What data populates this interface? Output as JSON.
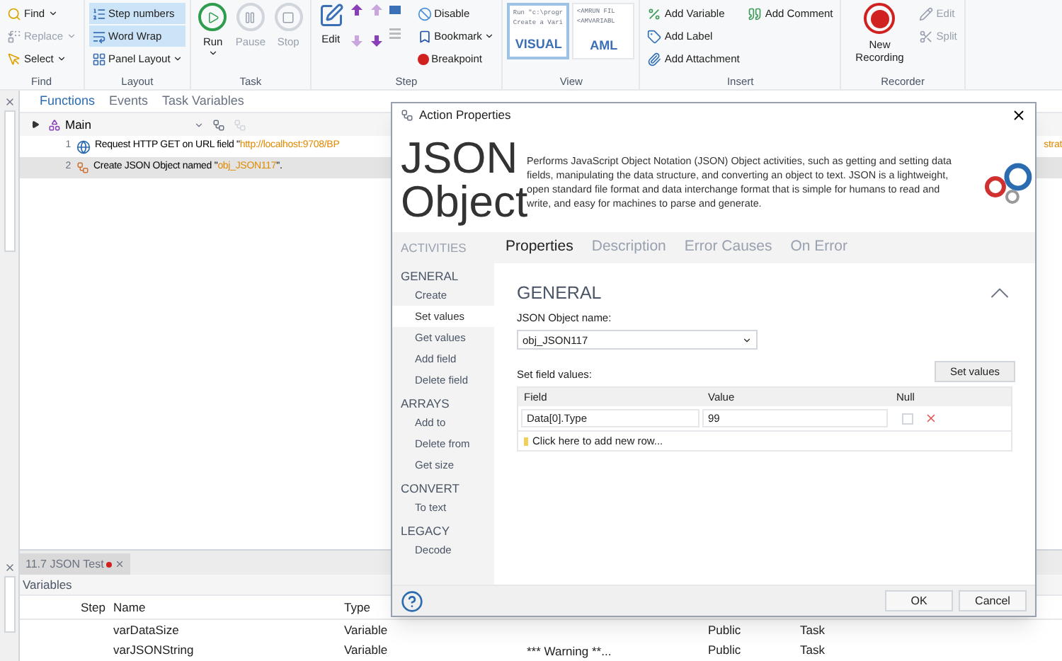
{
  "ribbon": {
    "groups": [
      {
        "label": "Find",
        "columns": [
          [
            {
              "kind": "small",
              "label": "Find",
              "dropdown": true,
              "disabled": false,
              "selected": false
            },
            {
              "kind": "small",
              "label": "Replace",
              "dropdown": true,
              "disabled": true,
              "selected": false
            },
            {
              "kind": "small",
              "label": "Select",
              "dropdown": true,
              "disabled": false,
              "selected": false
            }
          ]
        ]
      },
      {
        "label": "Layout",
        "columns": [
          [
            {
              "kind": "small",
              "label": "Step numbers",
              "dropdown": false,
              "disabled": false,
              "selected": true
            },
            {
              "kind": "small",
              "label": "Word Wrap",
              "dropdown": false,
              "disabled": false,
              "selected": true
            },
            {
              "kind": "small",
              "label": "Panel Layout",
              "dropdown": true,
              "disabled": false,
              "selected": false
            }
          ]
        ]
      },
      {
        "label": "Task",
        "columns": [
          [
            {
              "kind": "large",
              "label": "Run",
              "dropdown": true,
              "disabled": false,
              "selected": false
            }
          ],
          [
            {
              "kind": "large",
              "label": "Pause",
              "dropdown": false,
              "disabled": true,
              "selected": false
            }
          ],
          [
            {
              "kind": "large",
              "label": "Stop",
              "dropdown": false,
              "disabled": true,
              "selected": false
            }
          ]
        ]
      },
      {
        "label": "Step",
        "columns": [
          [
            {
              "kind": "large",
              "label": "Edit",
              "dropdown": false,
              "disabled": false,
              "selected": false
            }
          ],
          [
            {
              "kind": "arrows"
            }
          ],
          [
            {
              "kind": "small",
              "label": "Disable",
              "dropdown": false,
              "disabled": false,
              "selected": false
            },
            {
              "kind": "small",
              "label": "Bookmark",
              "dropdown": true,
              "disabled": false,
              "selected": false
            },
            {
              "kind": "small",
              "label": "Breakpoint",
              "dropdown": false,
              "disabled": false,
              "selected": false
            }
          ]
        ]
      },
      {
        "label": "View",
        "columns": [
          [
            {
              "kind": "thumb",
              "label": "VISUAL",
              "preview": [
                "Run \"c:\\progr",
                "Create a Vari"
              ],
              "selected": true
            }
          ],
          [
            {
              "kind": "thumb",
              "label": "AML",
              "preview": [
                "<AMRUN FIL",
                "<AMVARIABL"
              ],
              "selected": false
            }
          ]
        ]
      },
      {
        "label": "Insert",
        "columns": [
          [
            {
              "kind": "small",
              "label": "Add Variable",
              "dropdown": false,
              "disabled": false,
              "selected": false
            },
            {
              "kind": "small",
              "label": "Add Label",
              "dropdown": false,
              "disabled": false,
              "selected": false
            },
            {
              "kind": "small",
              "label": "Add Attachment",
              "dropdown": false,
              "disabled": false,
              "selected": false
            }
          ],
          [
            {
              "kind": "small",
              "label": "Add Comment",
              "dropdown": false,
              "disabled": false,
              "selected": false
            }
          ]
        ]
      },
      {
        "label": "Recorder",
        "columns": [
          [
            {
              "kind": "large",
              "label": "New Recording",
              "dropdown": false,
              "disabled": false,
              "selected": false
            }
          ],
          [
            {
              "kind": "small",
              "label": "Edit",
              "dropdown": false,
              "disabled": true,
              "selected": false
            },
            {
              "kind": "small",
              "label": "Split",
              "dropdown": false,
              "disabled": true,
              "selected": false
            }
          ]
        ]
      }
    ]
  },
  "editor": {
    "tabs": [
      {
        "label": "Functions",
        "selected": true
      },
      {
        "label": "Events",
        "selected": false
      },
      {
        "label": "Task Variables",
        "selected": false
      }
    ],
    "function": "Main",
    "steps": [
      {
        "number": "1",
        "kind": "http",
        "prefix": "Request HTTP GET on URL field \"",
        "value": "http://localhost:9708/BP",
        "tail": "strat",
        "selected": false
      },
      {
        "number": "2",
        "kind": "json",
        "prefix": "Create JSON Object named \"",
        "value": "obj_JSON117",
        "suffix": "\".",
        "selected": true
      }
    ]
  },
  "bottom_panel": {
    "tab": {
      "label": "11.7 JSON Test",
      "modified": true
    },
    "title": "Variables",
    "columns": [
      "Step",
      "Name",
      "Type"
    ],
    "rows": [
      {
        "name": "varDataSize",
        "type": "Variable",
        "column_5": "Public",
        "column_6": "Task"
      },
      {
        "name": "varJSONString",
        "type": "Variable",
        "column_4": "*** Warning **...",
        "column_5": "Public",
        "column_6": "Task"
      }
    ]
  },
  "dialog": {
    "title": "Action Properties",
    "heading": [
      "JSON",
      "Object"
    ],
    "description": "Performs JavaScript Object Notation (JSON) Object activities, such as getting and setting data fields, manipulating the data structure, and converting an object to text. JSON is a lightweight, open standard file format and data interchange format that is simple for humans to read and write, and easy for machines to parse and generate.",
    "nav_title": "ACTIVITIES",
    "nav": [
      {
        "label": "GENERAL",
        "items": [
          {
            "label": "Create",
            "selected": false
          },
          {
            "label": "Set values",
            "selected": true
          },
          {
            "label": "Get values",
            "selected": false
          },
          {
            "label": "Add field",
            "selected": false
          },
          {
            "label": "Delete field",
            "selected": false
          }
        ]
      },
      {
        "label": "ARRAYS",
        "items": [
          {
            "label": "Add to",
            "selected": false
          },
          {
            "label": "Delete from",
            "selected": false
          },
          {
            "label": "Get size",
            "selected": false
          }
        ]
      },
      {
        "label": "CONVERT",
        "items": [
          {
            "label": "To text",
            "selected": false
          }
        ]
      },
      {
        "label": "LEGACY",
        "items": [
          {
            "label": "Decode",
            "selected": false
          }
        ]
      }
    ],
    "tabs": [
      {
        "label": "Properties",
        "selected": true
      },
      {
        "label": "Description",
        "selected": false
      },
      {
        "label": "Error Causes",
        "selected": false
      },
      {
        "label": "On Error",
        "selected": false
      }
    ],
    "section": {
      "title": "GENERAL",
      "expanded": true
    },
    "object_name": {
      "label": "JSON Object name:",
      "value": "obj_JSON117"
    },
    "field_values": {
      "label": "Set field values:",
      "button": "Set values",
      "columns": [
        "Field",
        "Value",
        "Null"
      ],
      "rows": [
        {
          "field": "Data[0].Type",
          "value": "99",
          "null": false
        }
      ],
      "add_row": "Click here to add new row..."
    },
    "buttons": [
      "OK",
      "Cancel"
    ]
  }
}
